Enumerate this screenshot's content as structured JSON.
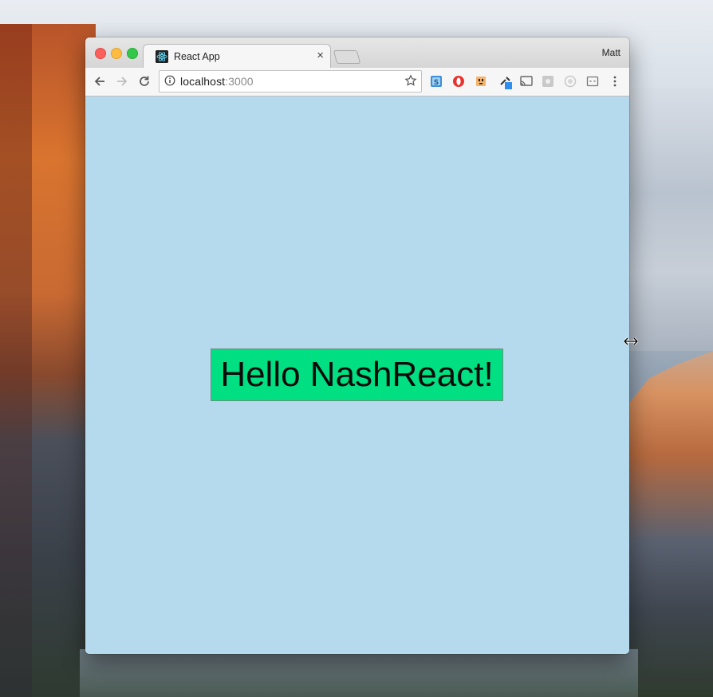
{
  "window": {
    "profile_name": "Matt"
  },
  "tab": {
    "title": "React App",
    "close_glyph": "×",
    "favicon": "react-logo-icon"
  },
  "toolbar": {
    "url_host": "localhost",
    "url_port": ":3000",
    "extensions": [
      "s-extension-icon",
      "opera-extension-icon",
      "face-extension-icon",
      "eyedropper-extension-icon",
      "cast-icon",
      "gray-extension-icon",
      "circle-extension-icon",
      "mask-extension-icon",
      "menu-icon"
    ]
  },
  "page": {
    "greeting": "Hello NashReact!"
  },
  "colors": {
    "page_background": "#b5daed",
    "greeting_background": "#00e083"
  }
}
